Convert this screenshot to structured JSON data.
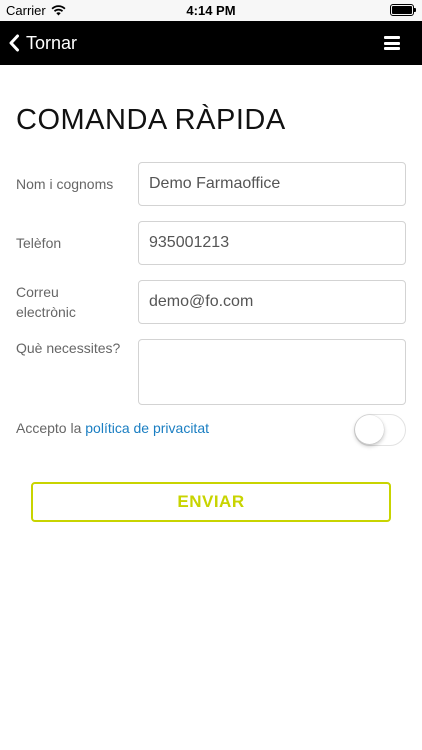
{
  "status_bar": {
    "carrier": "Carrier",
    "time": "4:14 PM",
    "wifi_icon": "wifi-icon",
    "battery_icon": "battery-icon",
    "battery_level": 1.0
  },
  "nav": {
    "back_label": "Tornar",
    "back_icon": "chevron-left-icon",
    "menu_icon": "hamburger-menu-icon",
    "background": "#000000"
  },
  "form": {
    "title": "COMANDA RÀPIDA",
    "fields": [
      {
        "label": "Nom i cognoms",
        "value": "Demo Farmaoffice"
      },
      {
        "label": "Telèfon",
        "value": "935001213"
      },
      {
        "label": "Correu electrònic",
        "value": "demo@fo.com"
      },
      {
        "label": "Què necessites?",
        "value": ""
      }
    ],
    "privacy": {
      "text": "Accepto la",
      "link": "política de privacitat",
      "accepted": false,
      "link_color": "#1a7ec2"
    },
    "submit_label": "ENVIAR",
    "accent_color": "#c8d400"
  }
}
